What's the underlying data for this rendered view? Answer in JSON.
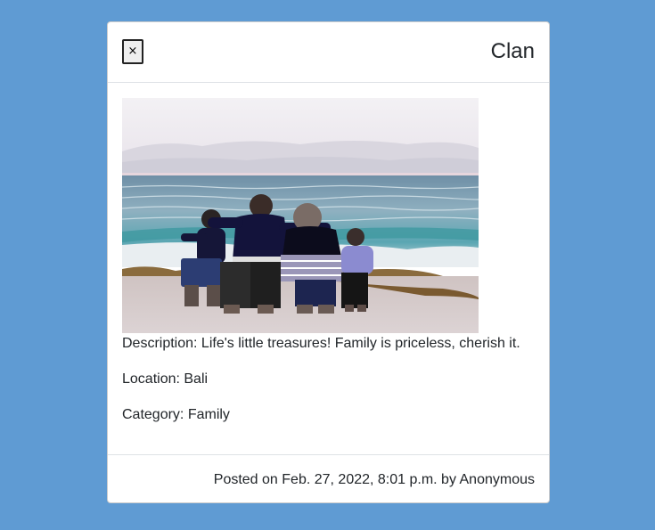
{
  "modal": {
    "close_label": "×",
    "title": "Clan"
  },
  "post": {
    "image": "family-at-beach-photo",
    "description": "Description: Life's little treasures! Family is priceless, cherish it.",
    "location": "Location: Bali",
    "category": "Category: Family"
  },
  "footer": {
    "posted": "Posted on Feb. 27, 2022, 8:01 p.m. by Anonymous"
  },
  "colors": {
    "page_background": "#5f9bd3",
    "modal_background": "#ffffff",
    "divider": "#dee2e6"
  }
}
